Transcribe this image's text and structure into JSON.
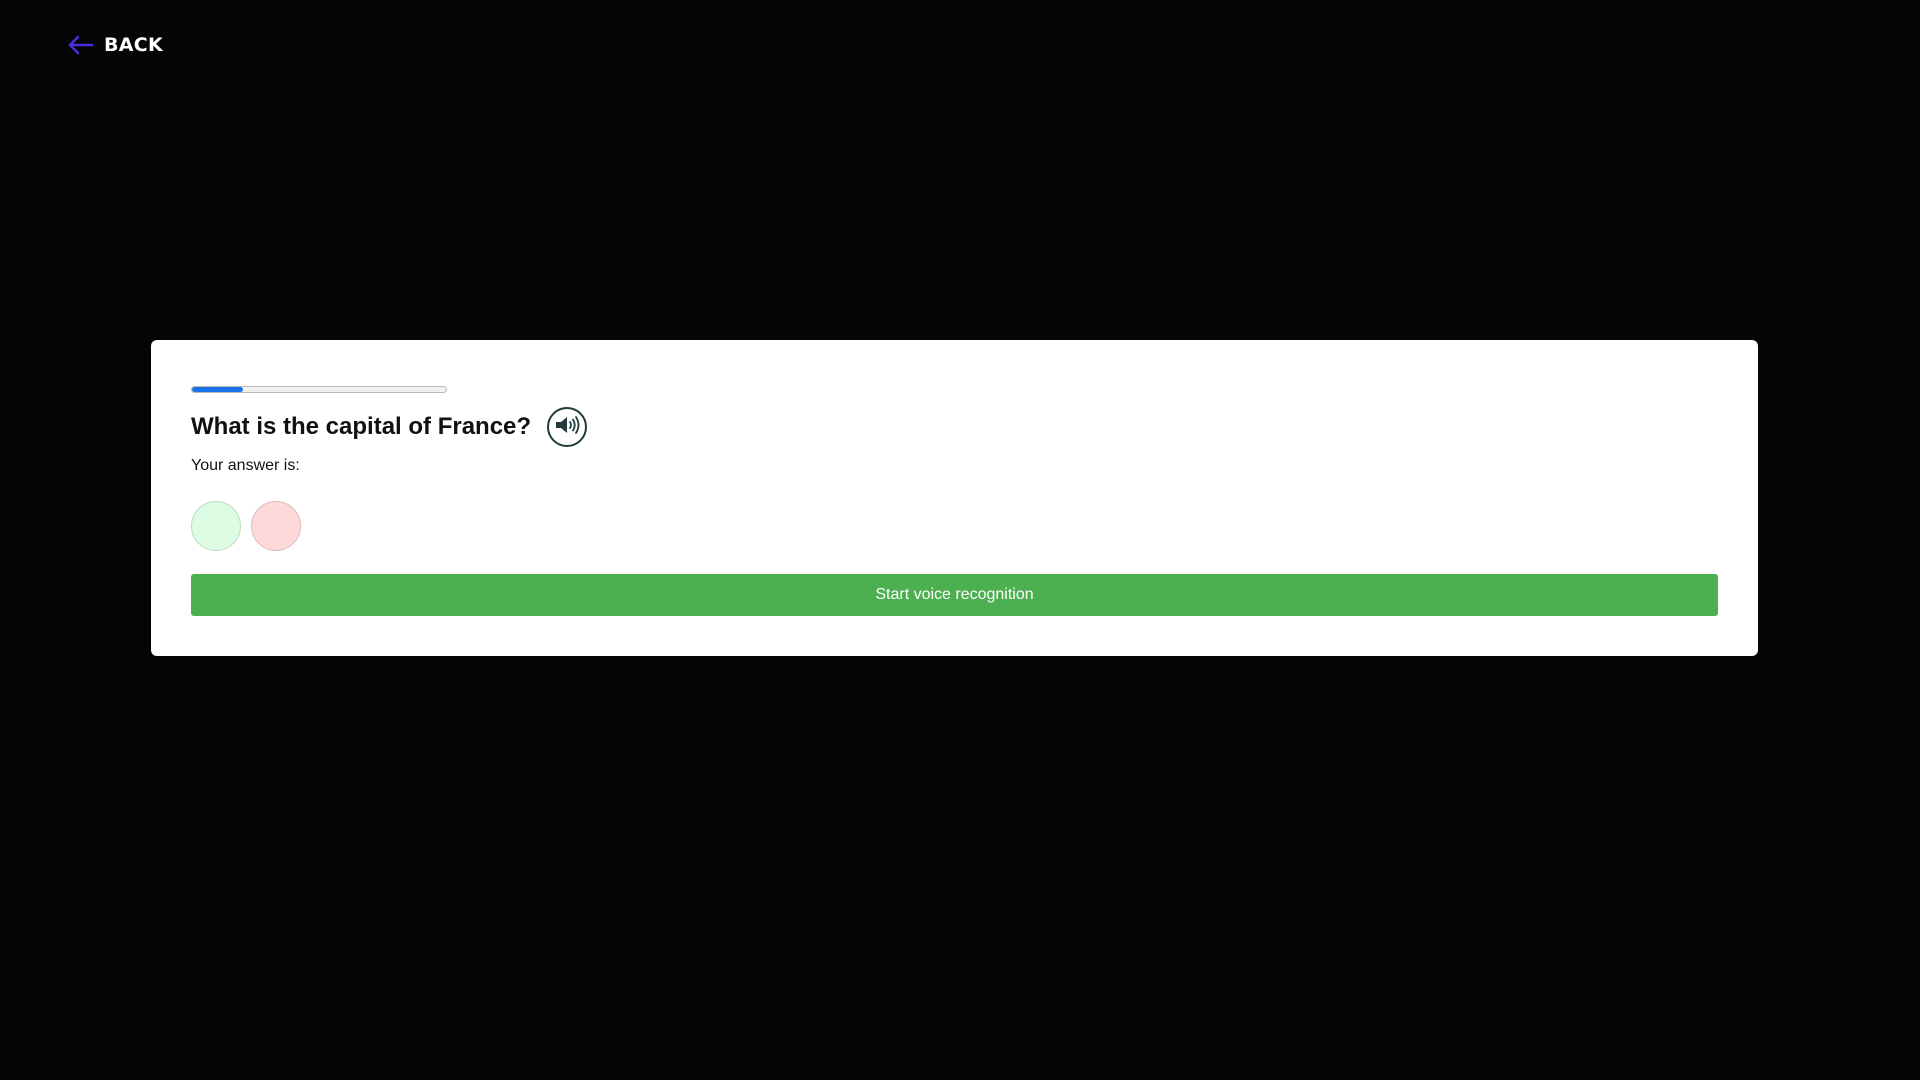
{
  "nav": {
    "back_label": "BACK",
    "back_icon": "arrow-left-icon",
    "back_icon_color": "#4a2ee0"
  },
  "quiz": {
    "progress_fraction": 0.2,
    "progress_color": "#1a73e8",
    "question": "What is the capital of France?",
    "speaker_icon": "speaker-icon",
    "answer_label": "Your answer is:",
    "answer_indicators": [
      {
        "name": "correct-indicator",
        "color": "#dcfce4"
      },
      {
        "name": "wrong-indicator",
        "color": "#fdd9d9"
      }
    ],
    "voice_button_label": "Start voice recognition",
    "voice_button_color": "#4caf50"
  }
}
